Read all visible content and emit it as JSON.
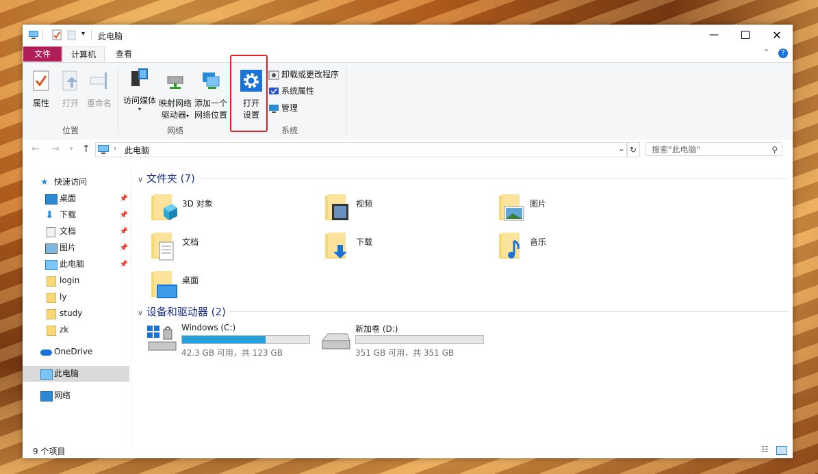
{
  "window": {
    "title": "此电脑"
  },
  "tabs": {
    "file": "文件",
    "computer": "计算机",
    "view": "查看"
  },
  "ribbon": {
    "properties": "属性",
    "open": "打开",
    "rename": "重命名",
    "group_location": "位置",
    "media_access_1": "访问媒体",
    "map_drive_1": "映射网络",
    "map_drive_2": "驱动器",
    "add_network_1": "添加一个",
    "add_network_2": "网络位置",
    "group_network": "网络",
    "open_settings_1": "打开",
    "open_settings_2": "设置",
    "uninstall": "卸载或更改程序",
    "system_props": "系统属性",
    "manage": "管理",
    "group_system": "系统"
  },
  "address": {
    "path": "此电脑",
    "search_placeholder": "搜索\"此电脑\""
  },
  "nav": {
    "quick_access": "快速访问",
    "items": [
      {
        "label": "桌面"
      },
      {
        "label": "下载"
      },
      {
        "label": "文档"
      },
      {
        "label": "图片"
      },
      {
        "label": "此电脑"
      },
      {
        "label": "login"
      },
      {
        "label": "ly"
      },
      {
        "label": "study"
      },
      {
        "label": "zk"
      }
    ],
    "onedrive": "OneDrive",
    "this_pc": "此电脑",
    "network": "网络"
  },
  "content": {
    "folders_header": "文件夹 (7)",
    "folders": [
      {
        "name": "3D 对象"
      },
      {
        "name": "视频"
      },
      {
        "name": "图片"
      },
      {
        "name": "文档"
      },
      {
        "name": "下载"
      },
      {
        "name": "音乐"
      },
      {
        "name": "桌面"
      }
    ],
    "drives_header": "设备和驱动器 (2)",
    "drives": [
      {
        "name": "Windows (C:)",
        "size": "42.3 GB 可用，共 123 GB",
        "used_fraction": 0.656
      },
      {
        "name": "新加卷 (D:)",
        "size": "351 GB 可用，共 351 GB",
        "used_fraction": 0.0
      }
    ]
  },
  "status": {
    "items": "9 个项目"
  },
  "colors": {
    "file_tab": "#b01e5a",
    "drive_fill": "#26a0da",
    "highlight": "#e02020"
  }
}
